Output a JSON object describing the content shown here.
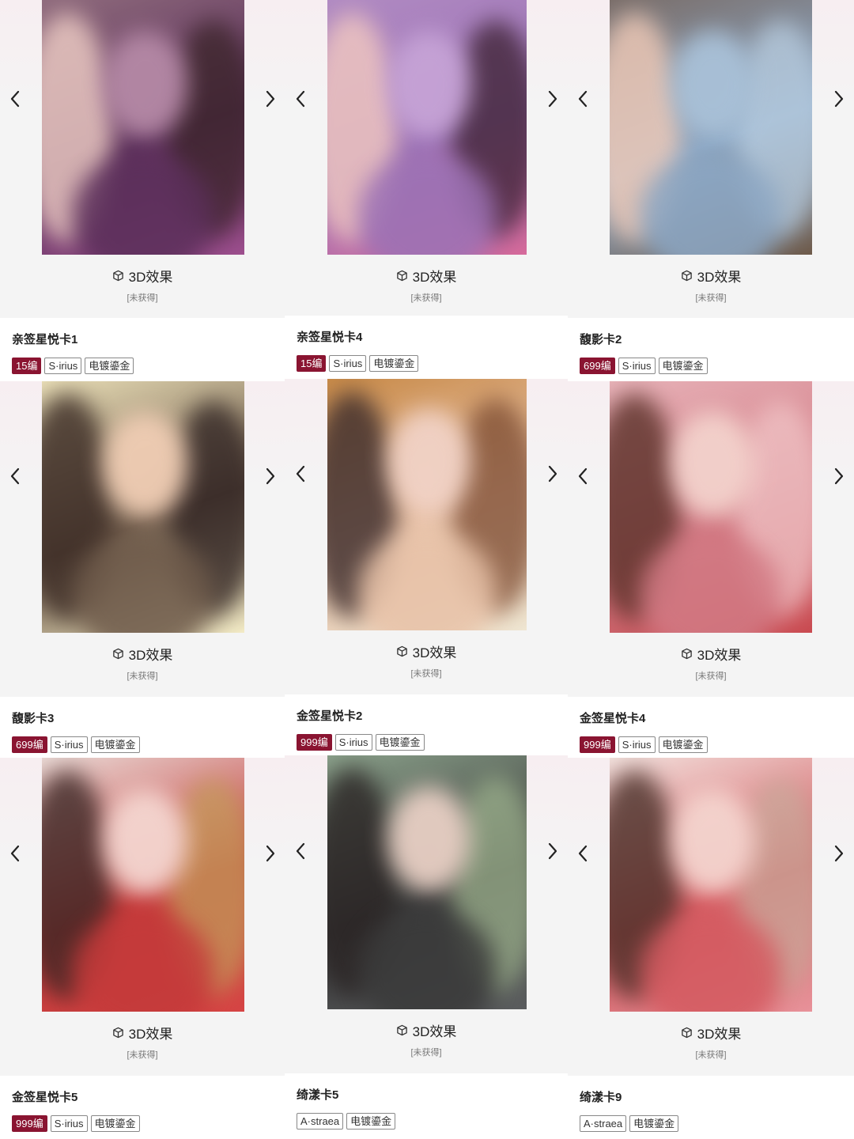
{
  "effect_label": "3D效果",
  "status_label": "[未获得]",
  "colors": {
    "edition_badge": "#8a1431",
    "media_bg": "#f4f4f4"
  },
  "icons": {
    "prev": "chevron-left-icon",
    "next": "chevron-right-icon",
    "effect": "cube-icon"
  },
  "top_row_media": [
    {},
    {},
    {}
  ],
  "cards": [
    {
      "name": "亲签星悦卡1",
      "edition": "15编",
      "tags": [
        "S·irius",
        "电镀鎏金"
      ]
    },
    {
      "name": "亲签星悦卡4",
      "edition": "15编",
      "tags": [
        "S·irius",
        "电镀鎏金"
      ]
    },
    {
      "name": "馥影卡2",
      "edition": "699编",
      "tags": [
        "S·irius",
        "电镀鎏金"
      ]
    },
    {
      "name": "馥影卡3",
      "edition": "699编",
      "tags": [
        "S·irius",
        "电镀鎏金"
      ]
    },
    {
      "name": "金签星悦卡2",
      "edition": "999编",
      "tags": [
        "S·irius",
        "电镀鎏金"
      ]
    },
    {
      "name": "金签星悦卡4",
      "edition": "999编",
      "tags": [
        "S·irius",
        "电镀鎏金"
      ]
    },
    {
      "name": "金签星悦卡5",
      "edition": "999编",
      "tags": [
        "S·irius",
        "电镀鎏金"
      ]
    },
    {
      "name": "绮漾卡5",
      "edition": "",
      "tags": [
        "A·straea",
        "电镀鎏金"
      ]
    },
    {
      "name": "绮漾卡9",
      "edition": "",
      "tags": [
        "A·straea",
        "电镀鎏金"
      ]
    }
  ]
}
